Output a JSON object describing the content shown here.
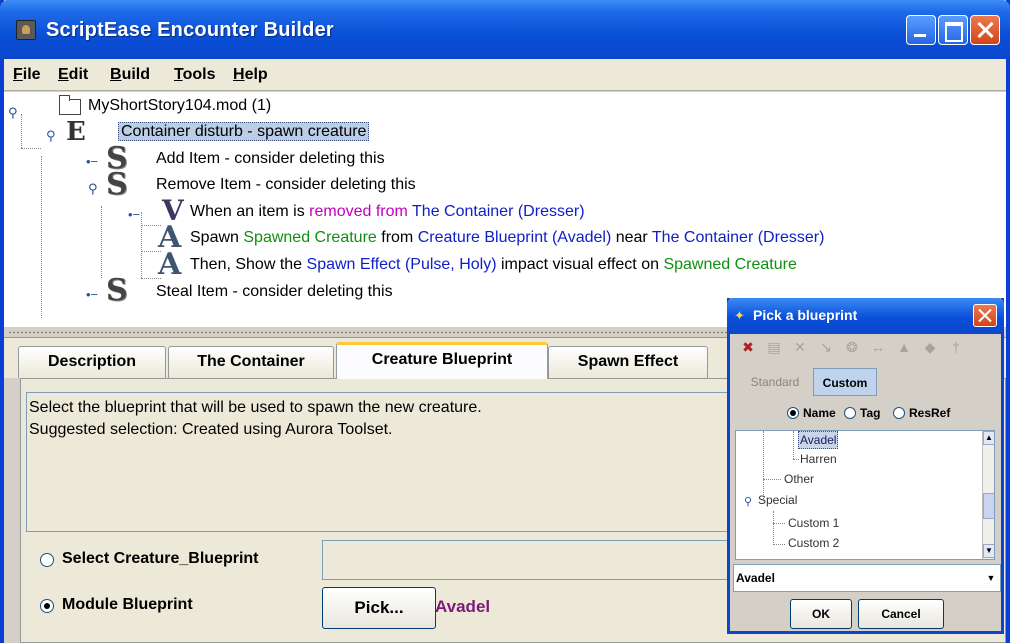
{
  "window": {
    "title": "ScriptEase Encounter Builder"
  },
  "menu": [
    {
      "first": "F",
      "rest": "ile"
    },
    {
      "first": "E",
      "rest": "dit"
    },
    {
      "first": "B",
      "rest": "uild"
    },
    {
      "first": "T",
      "rest": "ools"
    },
    {
      "first": "H",
      "rest": "elp"
    }
  ],
  "tree": {
    "root": "MyShortStory104.mod (1)",
    "encounter": "Container disturb - spawn creature",
    "add_item": "Add Item - consider deleting this",
    "remove_item": "Remove Item - consider deleting this",
    "when": {
      "a": "When an item is ",
      "b": "removed from",
      "c": " ",
      "d": "The Container (Dresser)"
    },
    "spawn": {
      "a": "Spawn ",
      "b": "Spawned Creature",
      "c": " from ",
      "d": "Creature Blueprint (Avadel)",
      "e": " near ",
      "f": "The Container (Dresser)"
    },
    "then": {
      "a": "Then, Show the ",
      "b": "Spawn Effect (Pulse, Holy)",
      "c": " impact visual effect on ",
      "d": "Spawned Creature"
    },
    "steal_item": "Steal Item - consider deleting this",
    "icons": {
      "E": "E",
      "S": "S",
      "V": "V",
      "A": "A"
    }
  },
  "tabs": [
    "Description",
    "The Container",
    "Creature Blueprint",
    "Spawn Effect"
  ],
  "description": {
    "line1": "Select the blueprint that will be used to spawn the new creature.",
    "line2": "Suggested selection: Created using Aurora Toolset."
  },
  "options": {
    "select_label": "Select Creature_Blueprint",
    "module_label": "Module Blueprint",
    "pick_label": "Pick...",
    "picked_value": "Avadel"
  },
  "dialog": {
    "title": "Pick a blueprint",
    "tabs": {
      "standard": "Standard",
      "custom": "Custom"
    },
    "radios": {
      "name": "Name",
      "tag": "Tag",
      "resref": "ResRef"
    },
    "list": {
      "avadel": "Avadel",
      "harren": "Harren",
      "other": "Other",
      "special": "Special",
      "custom1": "Custom 1",
      "custom2": "Custom 2"
    },
    "combo_value": "Avadel",
    "ok": "OK",
    "cancel": "Cancel"
  },
  "colors": {
    "title_blue": "#0a4fd8",
    "link_blue": "#1020c8",
    "green": "#109010",
    "magenta": "#c000c0",
    "picked_purple": "#7b1a7b",
    "active_tab_accent": "#ffc83c"
  }
}
